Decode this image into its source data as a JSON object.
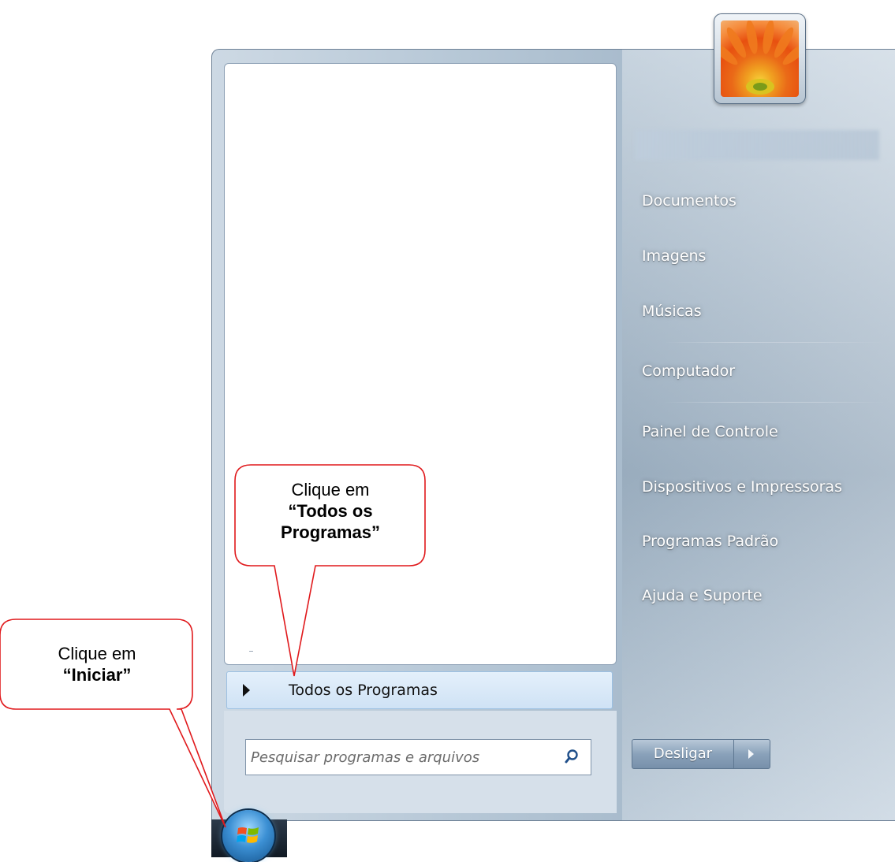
{
  "start_menu": {
    "all_programs_label": "Todos os Programas",
    "search_placeholder": "Pesquisar programas e arquivos",
    "right_items": [
      "Documentos",
      "Imagens",
      "Músicas",
      "Computador",
      "Painel de Controle",
      "Dispositivos e Impressoras",
      "Programas Padrão",
      "Ajuda e Suporte"
    ],
    "shutdown_label": "Desligar"
  },
  "callouts": {
    "todos": {
      "line1": "Clique em",
      "line2": "“Todos os",
      "line3": "Programas”"
    },
    "iniciar": {
      "line1": "Clique em",
      "line2": "“Iniciar”"
    }
  },
  "colors": {
    "callout_border": "#e0191c",
    "menu_glass": "#b7c8d7",
    "highlight": "#cfe2f5"
  },
  "icons": [
    "search-icon",
    "chevron-right-icon",
    "windows-start-orb",
    "user-picture-flower"
  ]
}
